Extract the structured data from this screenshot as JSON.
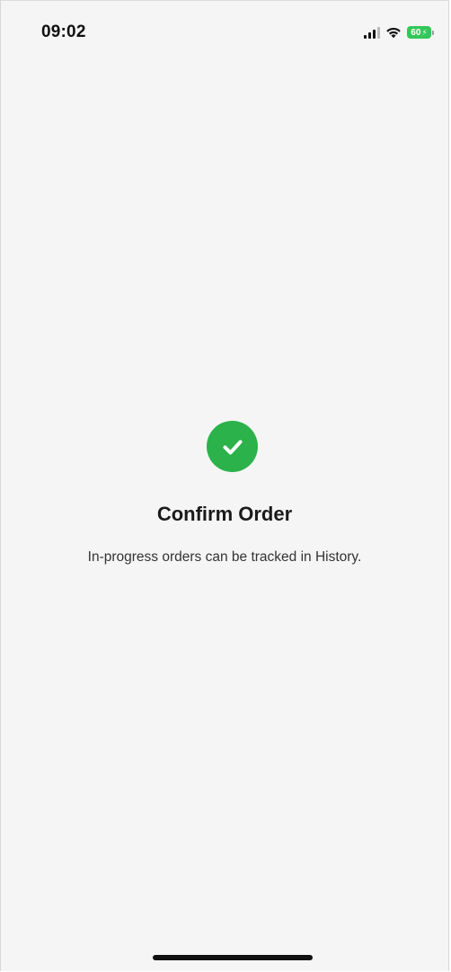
{
  "status_bar": {
    "time": "09:02",
    "battery_level": "60",
    "icons": [
      "signal-icon",
      "wifi-icon",
      "battery-icon",
      "charging-bolt-icon"
    ],
    "battery_color": "#33c759"
  },
  "confirmation": {
    "icon": "check-circle-icon",
    "icon_color": "#2bb24a",
    "title": "Confirm Order",
    "message": "In-progress orders can be tracked in History."
  }
}
